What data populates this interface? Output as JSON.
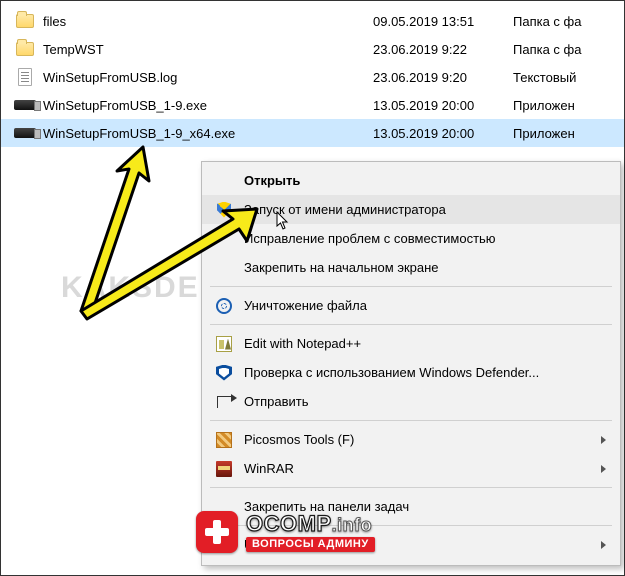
{
  "watermark_text": "KAKSDELAT.ORG",
  "files": [
    {
      "icon": "folder",
      "name": "files",
      "date": "09.05.2019 13:51",
      "type": "Папка с фа"
    },
    {
      "icon": "folder",
      "name": "TempWST",
      "date": "23.06.2019 9:22",
      "type": "Папка с фа"
    },
    {
      "icon": "txt",
      "name": "WinSetupFromUSB.log",
      "date": "23.06.2019 9:20",
      "type": "Текстовый"
    },
    {
      "icon": "usb",
      "name": "WinSetupFromUSB_1-9.exe",
      "date": "13.05.2019 20:00",
      "type": "Приложен"
    },
    {
      "icon": "usb",
      "name": "WinSetupFromUSB_1-9_x64.exe",
      "date": "13.05.2019 20:00",
      "type": "Приложен",
      "selected": true
    }
  ],
  "context_menu": {
    "open": "Открыть",
    "run_admin": "Запуск от имени администратора",
    "compat": "Исправление проблем с совместимостью",
    "pin_start": "Закрепить на начальном экране",
    "shred": "Уничтожение файла",
    "notepadpp": "Edit with Notepad++",
    "defender": "Проверка с использованием Windows Defender...",
    "send_to": "Отправить",
    "picosmos": "Picosmos Tools (F)",
    "winrar": "WinRAR",
    "pin_taskbar": "Закрепить на панели задач",
    "unlocker": "Unlocker"
  },
  "badge": {
    "brand": "OCOMP",
    "suffix": ".info",
    "tagline": "ВОПРОСЫ АДМИНУ"
  }
}
